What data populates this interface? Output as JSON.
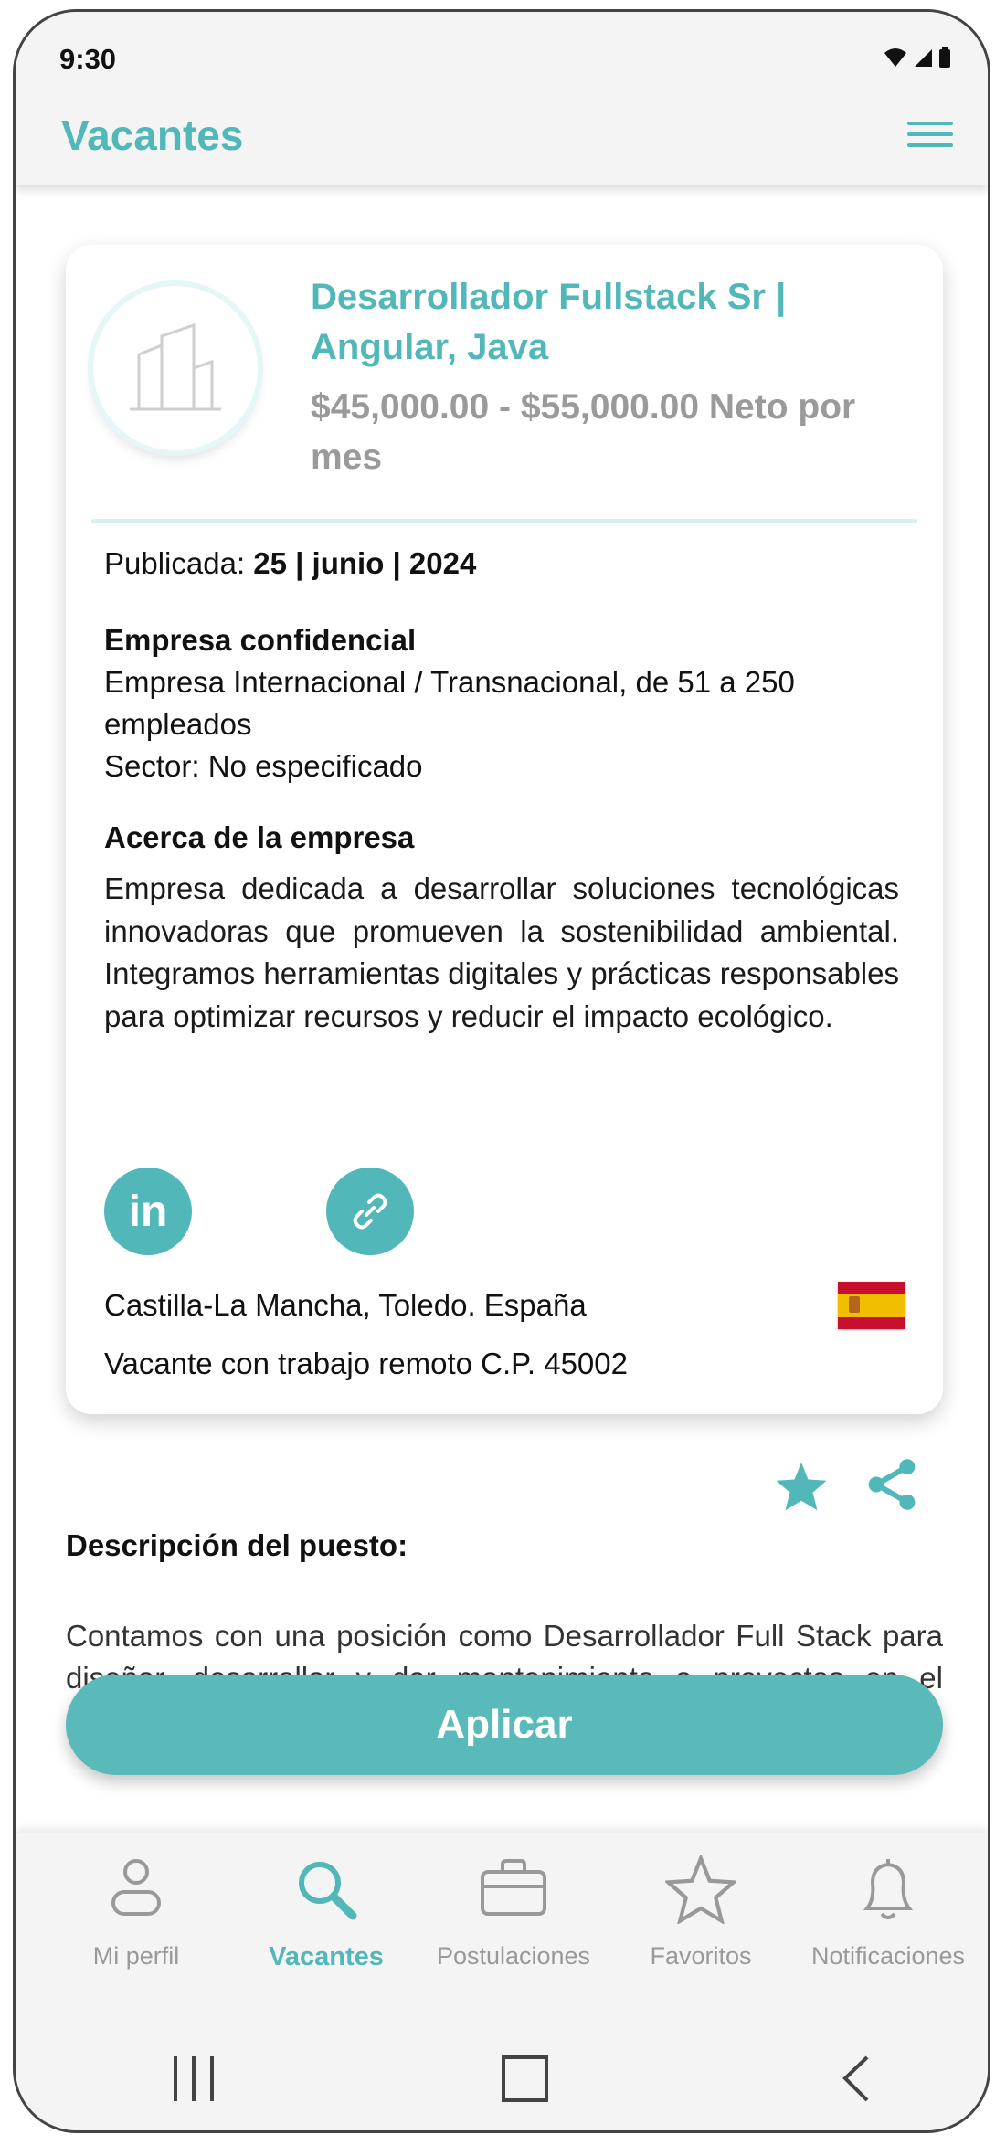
{
  "status": {
    "time": "9:30"
  },
  "appbar": {
    "title": "Vacantes"
  },
  "job": {
    "title": "Desarrollador Fullstack Sr | Angular, Java",
    "salary": "$45,000.00 - $55,000.00 Neto por mes",
    "published_label": "Publicada: ",
    "published_date": "25 | junio | 2024",
    "company_name": "Empresa confidencial",
    "company_type": "Empresa Internacional / Transnacional, de 51 a 250 empleados",
    "company_sector": "Sector: No especificado",
    "about_title": "Acerca de la empresa",
    "about_text": "Empresa dedicada a desarrollar soluciones tecnológicas innovadoras que promueven la sostenibilidad ambiental. Integramos herramientas digitales y prácticas responsables para optimizar recursos y reducir el impacto ecológico.",
    "location": "Castilla-La Mancha, Toledo. España",
    "remote": "Vacante con trabajo remoto C.P. 45002"
  },
  "description": {
    "title": "Descripción del puesto:",
    "text": "Contamos con una posición como Desarrollador Full Stack para diseñar, desarrollar y dar mantenimiento a proyectos en el desarrollo y mantenimiento de una aplicación web."
  },
  "apply_label": "Aplicar",
  "nav": [
    {
      "label": "Mi perfil",
      "icon": "person-icon"
    },
    {
      "label": "Vacantes",
      "icon": "search-icon"
    },
    {
      "label": "Postulaciones",
      "icon": "briefcase-icon"
    },
    {
      "label": "Favoritos",
      "icon": "star-icon"
    },
    {
      "label": "Notificaciones",
      "icon": "bell-icon"
    }
  ],
  "colors": {
    "accent": "#52b7b8",
    "inactive": "#999999"
  }
}
